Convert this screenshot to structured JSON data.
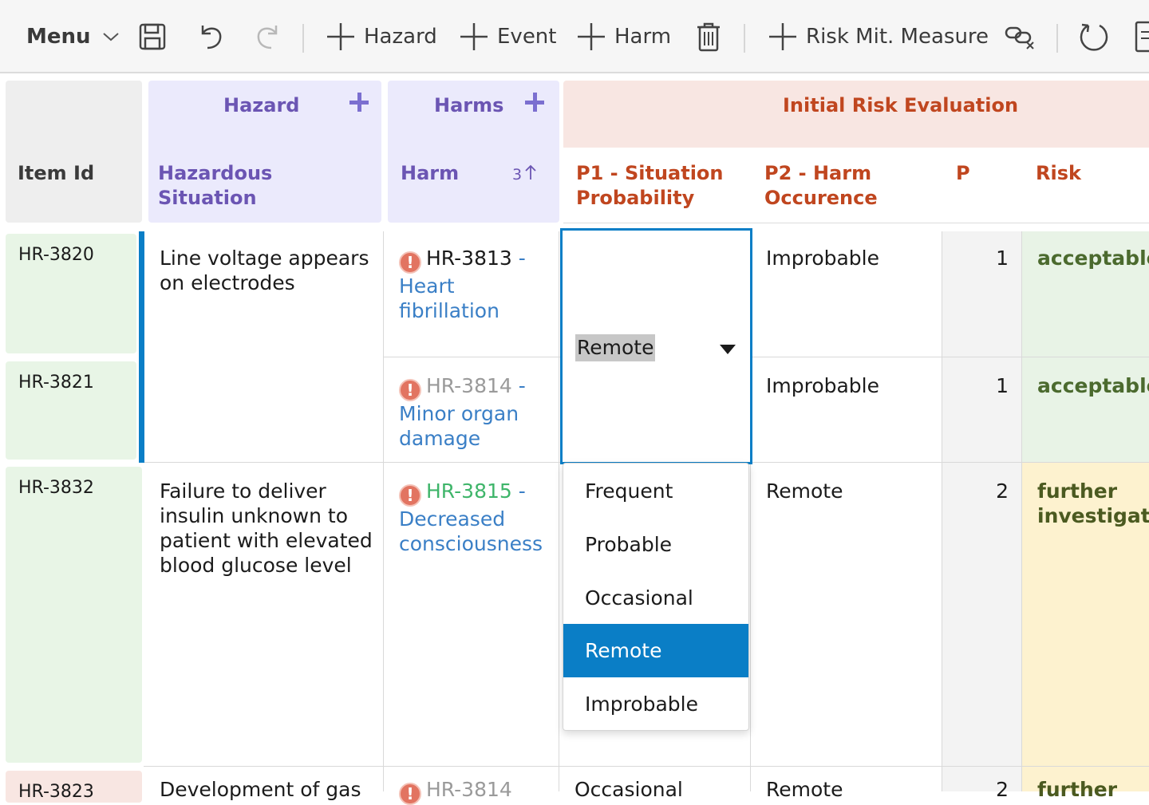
{
  "toolbar": {
    "menu_label": "Menu",
    "hazard_label": "Hazard",
    "event_label": "Event",
    "harm_label": "Harm",
    "risk_mit_label": "Risk Mit. Measure"
  },
  "header": {
    "item_id": "Item Id",
    "hazard_group": "Hazard",
    "hazardous_situation": [
      "Hazardous",
      "Situation"
    ],
    "harms_group": "Harms",
    "harm": "Harm",
    "harm_sort": "3",
    "initial_risk_group": "Initial Risk Evaluation",
    "p1": [
      "P1 - Situation",
      "Probability"
    ],
    "p2": [
      "P2 - Harm",
      "Occurence"
    ],
    "p": "P",
    "risk": "Risk"
  },
  "rows": [
    {
      "id": "HR-3820",
      "situation": [
        "Line voltage appears",
        "on electrodes"
      ],
      "harm_id": "HR-3813",
      "harm_dash": " -",
      "harm_name": [
        "Heart",
        "fibrillation"
      ],
      "p2": "Improbable",
      "p": "1",
      "risk": "acceptable"
    },
    {
      "id": "HR-3821",
      "harm_id": "HR-3814",
      "harm_dash": " -",
      "harm_name": [
        "Minor organ",
        "damage"
      ],
      "p2": "Improbable",
      "p": "1",
      "risk": "acceptable"
    },
    {
      "id": "HR-3832",
      "situation": [
        "Failure to deliver",
        "insulin unknown to",
        "patient with elevated",
        "blood glucose level"
      ],
      "harm_id": "HR-3815",
      "harm_dash": " -",
      "harm_name": [
        "Decreased",
        "consciousness"
      ],
      "p2": "Remote",
      "p": "2",
      "risk": [
        "further",
        "investigatio"
      ]
    },
    {
      "id": "HR-3823",
      "situation": "Development of gas",
      "harm_id": "HR-3814",
      "p1": "Occasional",
      "p2": "Remote",
      "p": "2",
      "risk": "further"
    }
  ],
  "p1_select": {
    "value": "Remote",
    "options": [
      "Frequent",
      "Probable",
      "Occasional",
      "Remote",
      "Improbable"
    ],
    "selected_index": 3
  },
  "colors": {
    "hazard_header": "#ebeafc",
    "harm_header_text": "#6b55b3",
    "risk_header": "#f8e6e2",
    "risk_header_text": "#c0461f",
    "id_cell": "#e8f5e6",
    "selection": "#0a7ec6"
  }
}
